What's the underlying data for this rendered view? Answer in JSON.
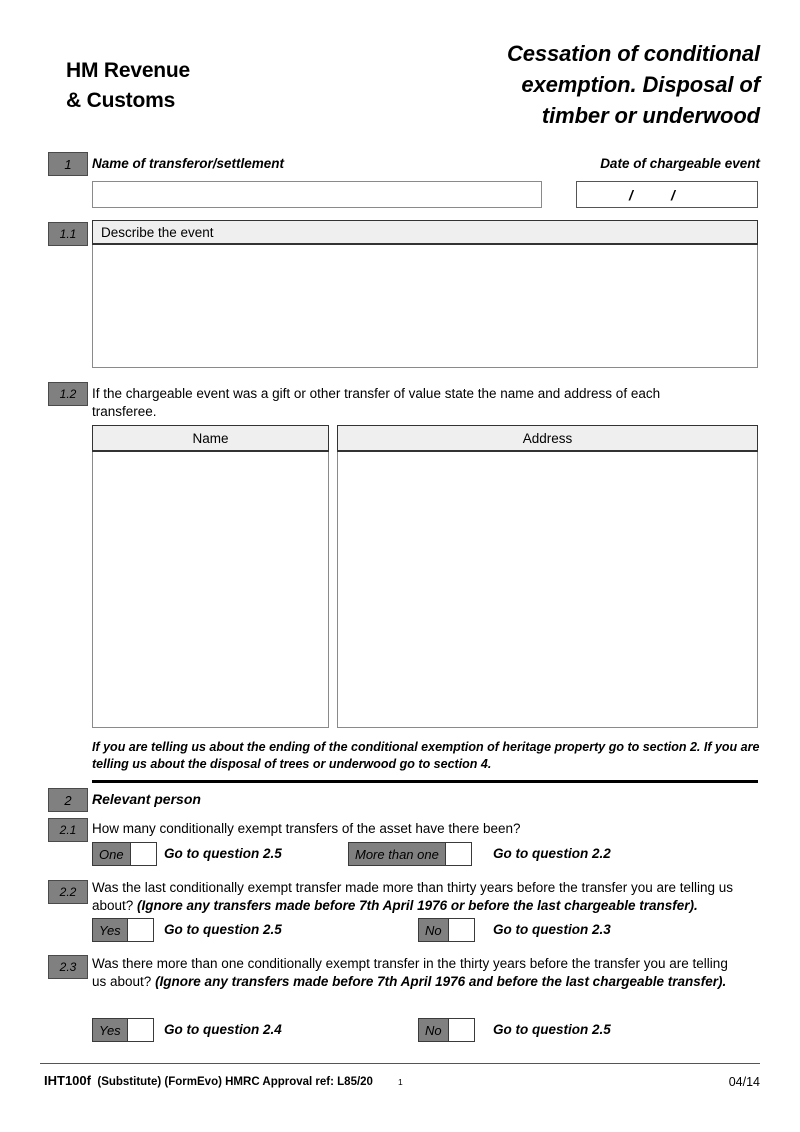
{
  "header": {
    "org_line1": "HM Revenue",
    "org_line2": "& Customs",
    "title_line1": "Cessation of conditional",
    "title_line2": "exemption.  Disposal of",
    "title_line3": "timber or underwood"
  },
  "section1": {
    "number": "1",
    "name_label": "Name of transferor/settlement",
    "name_value": "",
    "date_label": "Date of chargeable event",
    "date_slash_1": "/",
    "date_slash_2": "/",
    "q1_1": {
      "number": "1.1",
      "caption": "Describe the event",
      "value": ""
    },
    "q1_2": {
      "number": "1.2",
      "prompt": "If the chargeable event was a gift or other transfer of value state the name and address of each transferee.",
      "col_name_header": "Name",
      "col_address_header": "Address",
      "name_value": "",
      "address_value": ""
    },
    "note": "If you are telling us about the ending of the conditional exemption of heritage property go to section 2.  If you are telling us about the disposal of trees or underwood go to section 4."
  },
  "section2": {
    "number": "2",
    "heading": "Relevant person",
    "q2_1": {
      "number": "2.1",
      "prompt": "How many conditionally exempt transfers of the asset have there been?",
      "options": [
        {
          "label": "One",
          "goto": "Go to question 2.5"
        },
        {
          "label": "More than one",
          "goto": "Go to question 2.2"
        }
      ]
    },
    "q2_2": {
      "number": "2.2",
      "prompt_part1": "Was the last conditionally exempt transfer made more than thirty years before the transfer you are telling us about?  ",
      "prompt_italic": "(Ignore any transfers made before 7th April 1976 or before the last chargeable transfer).",
      "options": [
        {
          "label": "Yes",
          "goto": "Go to question 2.5"
        },
        {
          "label": "No",
          "goto": "Go to question 2.3"
        }
      ]
    },
    "q2_3": {
      "number": "2.3",
      "prompt_part1": "Was there more than one conditionally exempt transfer in the thirty years before the transfer you are telling us about?  ",
      "prompt_italic": "(Ignore any transfers made before 7th April 1976 and before the last chargeable transfer).",
      "options": [
        {
          "label": "Yes",
          "goto": "Go to question 2.4"
        },
        {
          "label": "No",
          "goto": "Go to question 2.5"
        }
      ]
    }
  },
  "footer": {
    "form_code": "IHT100f",
    "approval": "(Substitute) (FormEvo) HMRC Approval ref: L85/20",
    "page_number": "1",
    "revision_date": "04/14"
  }
}
